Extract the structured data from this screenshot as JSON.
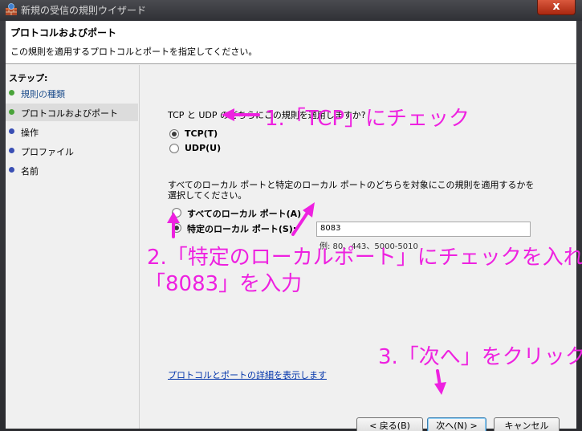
{
  "window": {
    "title": "新規の受信の規則ウイザード",
    "close_label": "x"
  },
  "header": {
    "title": "プロトコルおよびポート",
    "subtitle": "この規則を適用するプロトコルとポートを指定してください。"
  },
  "steps": {
    "title": "ステップ:",
    "items": [
      {
        "label": "規則の種類",
        "state": "done"
      },
      {
        "label": "プロトコルおよびポート",
        "state": "current"
      },
      {
        "label": "操作",
        "state": "todo"
      },
      {
        "label": "プロファイル",
        "state": "todo"
      },
      {
        "label": "名前",
        "state": "todo"
      }
    ]
  },
  "protocol": {
    "question": "TCP と UDP のどちらにこの規則を適用しますか?",
    "tcp_label": "TCP(T)",
    "udp_label": "UDP(U)"
  },
  "ports": {
    "question": "すべてのローカル ポートと特定のローカル ポートのどちらを対象にこの規則を適用するかを選択してください。",
    "all_label": "すべてのローカル ポート(A)",
    "specific_label": "特定のローカル ポート(S):",
    "value": "8083",
    "example": "例: 80、443、5000-5010"
  },
  "link_text": "プロトコルとポートの詳細を表示します",
  "buttons": {
    "back": "< 戻る(B)",
    "next": "次へ(N) >",
    "cancel": "キャンセル"
  },
  "annotations": {
    "a1": "1.「TCP」にチェック",
    "a2_line1": "2.「特定のローカルポート」にチェックを入れ",
    "a2_line2": "「8083」を入力",
    "a3": "3.「次へ」をクリック"
  },
  "colors": {
    "annotation": "#ee21e0",
    "titlebar": "#303136",
    "close_button": "#c0391c"
  }
}
